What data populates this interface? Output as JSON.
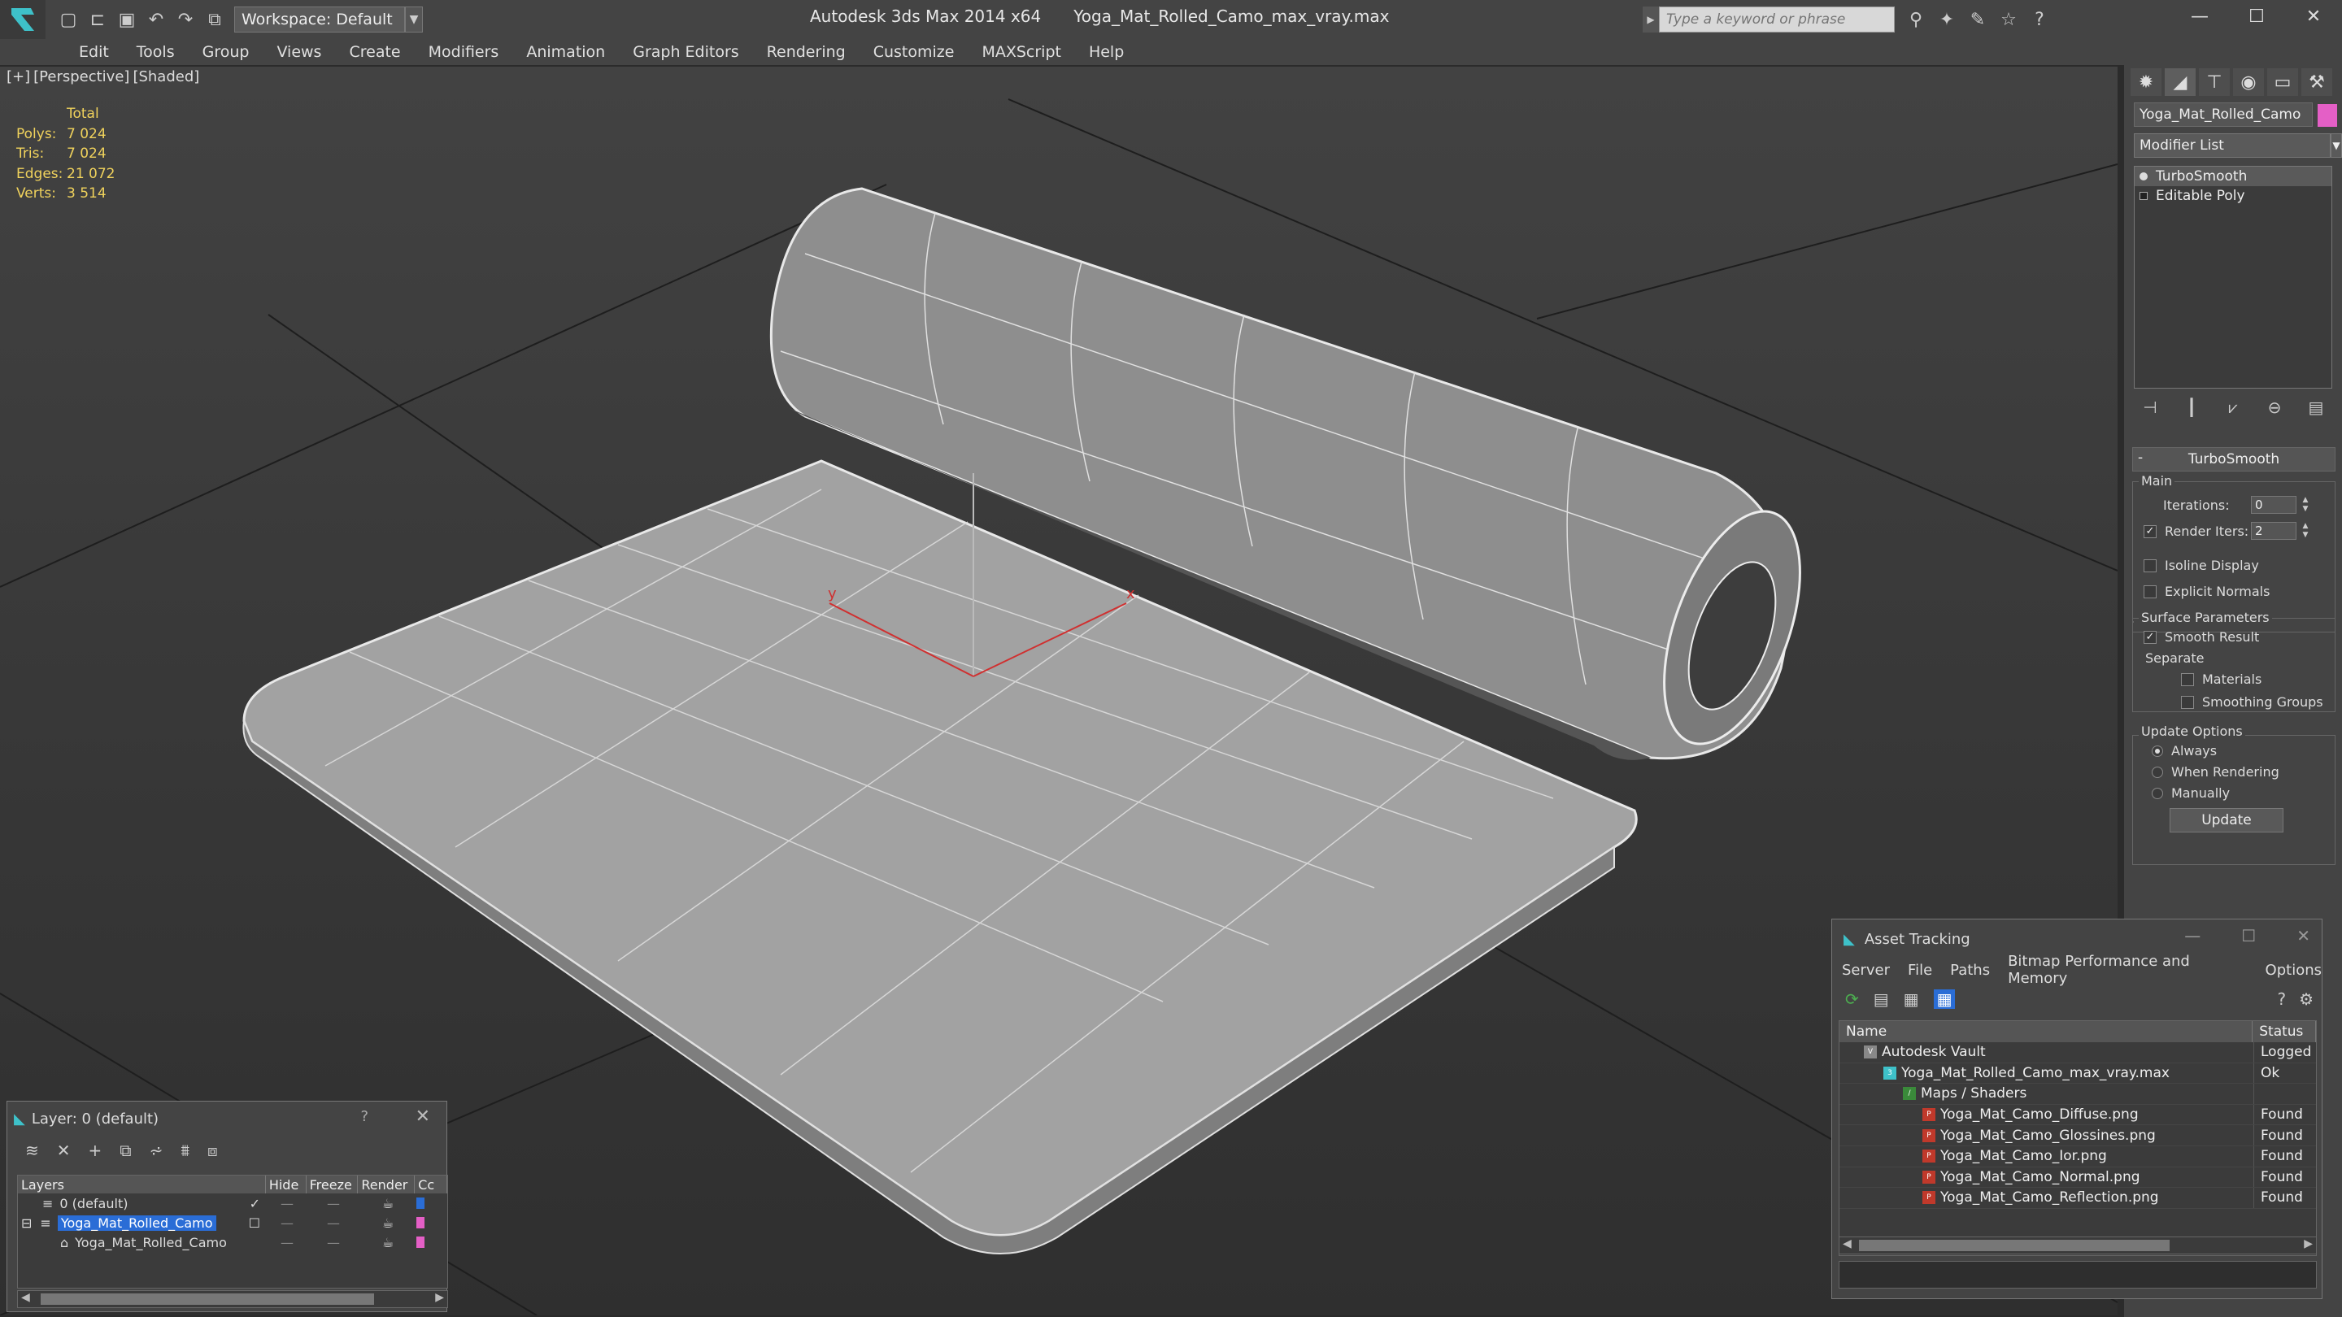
{
  "app": {
    "title": "Autodesk 3ds Max  2014 x64",
    "file": "Yoga_Mat_Rolled_Camo_max_vray.max",
    "workspace": "Workspace: Default",
    "search_placeholder": "Type a keyword or phrase"
  },
  "menu": [
    "Edit",
    "Tools",
    "Group",
    "Views",
    "Create",
    "Modifiers",
    "Animation",
    "Graph Editors",
    "Rendering",
    "Customize",
    "MAXScript",
    "Help"
  ],
  "viewport": {
    "label_plus": "[+]",
    "label_view": "[Perspective]",
    "label_shade": "[Shaded]",
    "stats_header": "Total",
    "stats": [
      {
        "k": "Polys:",
        "v": "7 024"
      },
      {
        "k": "Tris:",
        "v": "7 024"
      },
      {
        "k": "Edges:",
        "v": "21 072"
      },
      {
        "k": "Verts:",
        "v": "3 514"
      }
    ],
    "axis_x": "x",
    "axis_y": "y"
  },
  "command_panel": {
    "object_name": "Yoga_Mat_Rolled_Camo",
    "object_color": "#e45fc6",
    "modifier_list": "Modifier List",
    "stack": [
      "TurboSmooth",
      "Editable Poly"
    ],
    "rollout": "TurboSmooth",
    "main_label": "Main",
    "iterations_label": "Iterations:",
    "iterations_value": "0",
    "render_iters_label": "Render Iters:",
    "render_iters_value": "2",
    "isoline": "Isoline Display",
    "explicit_normals": "Explicit Normals",
    "surface_params": "Surface Parameters",
    "smooth_result": "Smooth Result",
    "separate": "Separate",
    "materials": "Materials",
    "smoothing_groups": "Smoothing Groups",
    "update_options": "Update Options",
    "always": "Always",
    "when_rendering": "When Rendering",
    "manually": "Manually",
    "update_button": "Update"
  },
  "layer_dialog": {
    "title": "Layer: 0 (default)",
    "help": "?",
    "columns": [
      "Layers",
      "Hide",
      "Freeze",
      "Render",
      "Cc"
    ],
    "rows": [
      {
        "name": "0 (default)"
      },
      {
        "name": "Yoga_Mat_Rolled_Camo"
      },
      {
        "name": "Yoga_Mat_Rolled_Camo"
      }
    ]
  },
  "asset_tracking": {
    "title": "Asset Tracking",
    "menu": [
      "Server",
      "File",
      "Paths",
      "Bitmap Performance and Memory",
      "Options"
    ],
    "col_name": "Name",
    "col_status": "Status",
    "rows": [
      {
        "name": "Autodesk Vault",
        "status": "Logged"
      },
      {
        "name": "Yoga_Mat_Rolled_Camo_max_vray.max",
        "status": "Ok"
      },
      {
        "name": "Maps / Shaders",
        "status": ""
      },
      {
        "name": "Yoga_Mat_Camo_Diffuse.png",
        "status": "Found"
      },
      {
        "name": "Yoga_Mat_Camo_Glossines.png",
        "status": "Found"
      },
      {
        "name": "Yoga_Mat_Camo_Ior.png",
        "status": "Found"
      },
      {
        "name": "Yoga_Mat_Camo_Normal.png",
        "status": "Found"
      },
      {
        "name": "Yoga_Mat_Camo_Reflection.png",
        "status": "Found"
      }
    ]
  }
}
